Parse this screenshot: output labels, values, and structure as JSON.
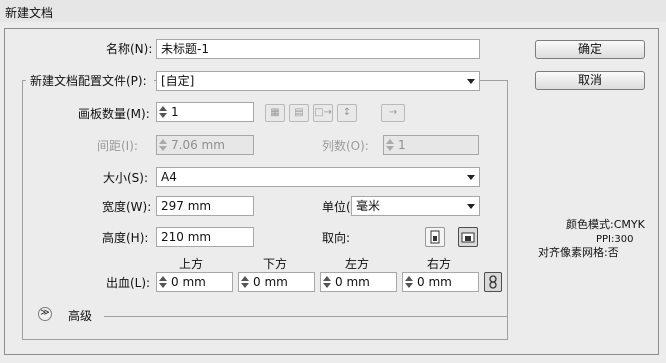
{
  "window": {
    "title": "新建文档"
  },
  "name": {
    "label": "名称(N):",
    "value": "未标题-1"
  },
  "profile": {
    "label": "新建文档配置文件(P):",
    "value": "[自定]"
  },
  "artboards": {
    "label": "画板数量(M):",
    "value": "1"
  },
  "spacing": {
    "label": "间距(I):",
    "value": "7.06 mm"
  },
  "columns": {
    "label": "列数(O):",
    "value": "1"
  },
  "size": {
    "label": "大小(S):",
    "value": "A4"
  },
  "width": {
    "label": "宽度(W):",
    "value": "297 mm"
  },
  "units": {
    "label": "单位(U):",
    "value": "毫米"
  },
  "height": {
    "label": "高度(H):",
    "value": "210 mm"
  },
  "orientation": {
    "label": "取向:",
    "selected": "landscape"
  },
  "bleed": {
    "label": "出血(L):",
    "top": {
      "label": "上方",
      "value": "0 mm"
    },
    "bottom": {
      "label": "下方",
      "value": "0 mm"
    },
    "left": {
      "label": "左方",
      "value": "0 mm"
    },
    "right": {
      "label": "右方",
      "value": "0 mm"
    }
  },
  "advanced": {
    "label": "高级"
  },
  "buttons": {
    "ok": "确定",
    "cancel": "取消"
  },
  "info": {
    "color_mode": "颜色模式:CMYK",
    "ppi": "PPI:300",
    "pixel_grid": "对齐像素网格:否"
  },
  "icons": {
    "arrange_grid_by_row": "grid-by-row-icon",
    "arrange_grid_by_column": "grid-by-column-icon",
    "arrange_by_row": "arrange-by-row-icon",
    "arrange_by_column": "arrange-by-column-icon",
    "layout_direction": "right-to-left-icon",
    "chain_link": "link-icon",
    "expand": "chevron-double-down-icon"
  }
}
